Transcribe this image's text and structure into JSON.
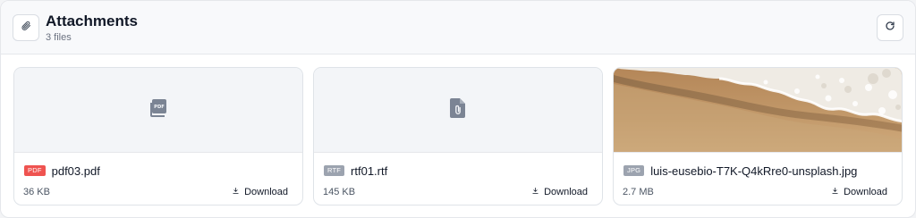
{
  "header": {
    "title": "Attachments",
    "subtitle": "3 files",
    "attach_icon": "paperclip-icon",
    "refresh_icon": "refresh-icon"
  },
  "attachments": [
    {
      "name": "pdf03.pdf",
      "badge": "PDF",
      "badge_color": "#ef5350",
      "size": "36 KB",
      "download_label": "Download",
      "preview": "pdf-file-icon"
    },
    {
      "name": "rtf01.rtf",
      "badge": "RTF",
      "badge_color": "#9ca3af",
      "size": "145 KB",
      "download_label": "Download",
      "preview": "attachment-file-icon"
    },
    {
      "name": "luis-eusebio-T7K-Q4kRre0-unsplash.jpg",
      "badge": "JPG",
      "badge_color": "#9ca3af",
      "size": "2.7 MB",
      "download_label": "Download",
      "preview": "beach-photo"
    }
  ]
}
